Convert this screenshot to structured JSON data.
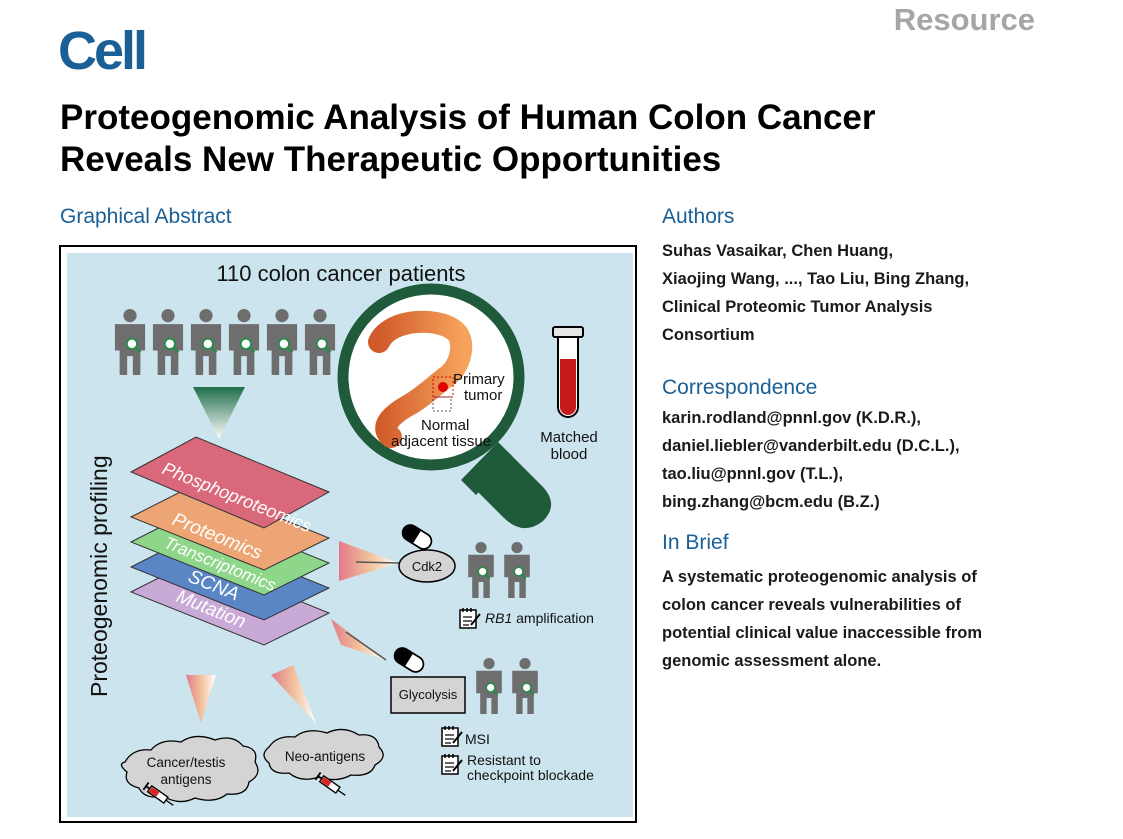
{
  "header": {
    "section_label": "Resource",
    "journal_logo": "Cell"
  },
  "article": {
    "title_line1": "Proteogenomic Analysis of Human Colon Cancer",
    "title_line2": "Reveals New Therapeutic Opportunities"
  },
  "graphical_abstract": {
    "heading": "Graphical Abstract",
    "patients_label": "110 colon cancer patients",
    "side_label": "Proteogenomic profiling",
    "primary_tumor": [
      "Primary",
      "tumor"
    ],
    "normal_tissue": [
      "Normal",
      "adjacent tissue"
    ],
    "matched_blood": [
      "Matched",
      "blood"
    ],
    "layers": [
      "Phosphoproteomics",
      "Proteomics",
      "Transcriptomics",
      "SCNA",
      "Mutation"
    ],
    "cdk2": "Cdk2",
    "rb1_gene": "RB1",
    "rb1_rest": " amplification",
    "glycolysis": "Glycolysis",
    "msi": "MSI",
    "resistant": [
      "Resistant to",
      "checkpoint blockade"
    ],
    "cancer_testis": [
      "Cancer/testis",
      "antigens"
    ],
    "neo_antigens": "Neo-antigens"
  },
  "authors": {
    "heading": "Authors",
    "lines": [
      "Suhas Vasaikar, Chen Huang,",
      "Xiaojing Wang, ..., Tao Liu, Bing Zhang,",
      "Clinical Proteomic Tumor Analysis",
      "Consortium"
    ]
  },
  "correspondence": {
    "heading": "Correspondence",
    "lines": [
      "karin.rodland@pnnl.gov (K.D.R.),",
      "daniel.liebler@vanderbilt.edu (D.C.L.),",
      "tao.liu@pnnl.gov (T.L.),",
      "bing.zhang@bcm.edu (B.Z.)"
    ]
  },
  "in_brief": {
    "heading": "In Brief",
    "lines": [
      "A systematic proteogenomic analysis of",
      "colon cancer reveals vulnerabilities of",
      "potential clinical value inaccessible from",
      "genomic assessment alone."
    ]
  },
  "colors": {
    "cell_blue": "#1a5f96",
    "panel_bg": "#cce4ee",
    "magnifier_green": "#1f5a3a",
    "layer_phospho": "#d9687a",
    "layer_proteo": "#eea576",
    "layer_transcripto": "#8ed68a",
    "layer_scna": "#5b86c6",
    "layer_mutation": "#c9a9d6"
  }
}
